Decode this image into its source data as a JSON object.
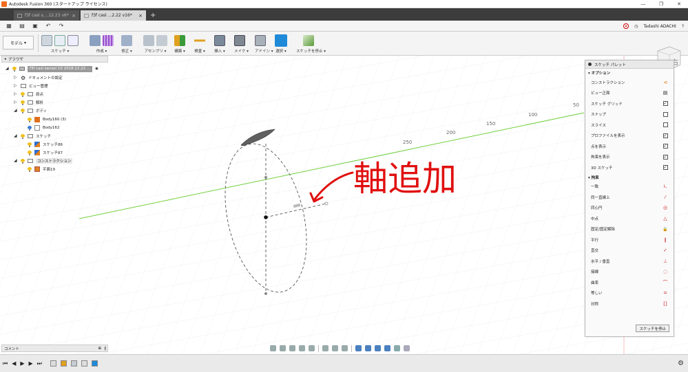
{
  "window": {
    "title": "Autodesk Fusion 360 (スタートアップ ライセンス)",
    "controls": [
      "—",
      "❐",
      "✕"
    ]
  },
  "tabs": [
    {
      "label": "f3f casl s....12.23  v6*",
      "active": false
    },
    {
      "label": "f3f casl ...2.22 v16*",
      "active": true
    }
  ],
  "quickbar": {
    "user": "Tadashi ADACHI",
    "help": "?"
  },
  "toolbar": {
    "workspace": "モデル",
    "groups": [
      {
        "label": "スケッチ ▾",
        "icons": 3
      },
      {
        "label": "作成 ▾",
        "icons": 2
      },
      {
        "label": "修正 ▾",
        "icons": 1
      },
      {
        "label": "アセンブリ ▾",
        "icons": 2
      },
      {
        "label": "構築 ▾",
        "icons": 1
      },
      {
        "label": "検査 ▾",
        "icons": 1
      },
      {
        "label": "挿入 ▾",
        "icons": 1
      },
      {
        "label": "メイク ▾",
        "icons": 1
      },
      {
        "label": "アドイン ▾",
        "icons": 1
      },
      {
        "label": "選択 ▾",
        "icons": 1
      },
      {
        "label": "スケッチを停止 ▾",
        "icons": 1
      }
    ]
  },
  "browser": {
    "title": "ブラウザ",
    "root": "f3f casl sensei 10 2018.12.22 ...",
    "items": [
      {
        "label": "ドキュメントの設定",
        "level": 1
      },
      {
        "label": "ビュー管理",
        "level": 1
      },
      {
        "label": "原点",
        "level": 1
      },
      {
        "label": "解析",
        "level": 1
      },
      {
        "label": "ボディ",
        "level": 1
      },
      {
        "label": "Body160 (3)",
        "level": 2
      },
      {
        "label": "Body162",
        "level": 2
      },
      {
        "label": "スケッチ",
        "level": 1
      },
      {
        "label": "スケッチ86",
        "level": 2
      },
      {
        "label": "スケッチ87",
        "level": 2
      },
      {
        "label": "コンストラクション",
        "level": 1
      },
      {
        "label": "平面19",
        "level": 2
      }
    ]
  },
  "comments": {
    "label": "コメント"
  },
  "viewport": {
    "axis_labels": [
      "250",
      "200",
      "150",
      "100",
      "50"
    ],
    "annotation": "軸追加",
    "viewcube_face": "右"
  },
  "palette": {
    "title": "スケッチ パレット",
    "options_header": "▾ オプション",
    "options": [
      {
        "label": "コンストラクション",
        "control": "⊲"
      },
      {
        "label": "ビュー正面",
        "control": "▤"
      },
      {
        "label": "スケッチ グリッド",
        "control": "✓"
      },
      {
        "label": "スナップ",
        "control": ""
      },
      {
        "label": "スライス",
        "control": ""
      },
      {
        "label": "プロファイルを表示",
        "control": "✓"
      },
      {
        "label": "点を表示",
        "control": "✓"
      },
      {
        "label": "拘束を表示",
        "control": "✓"
      },
      {
        "label": "3D スケッチ",
        "control": "✓"
      }
    ],
    "constraints_header": "▾ 拘束",
    "constraints": [
      {
        "label": "一致",
        "icon": "∟"
      },
      {
        "label": "同一直線上",
        "icon": "⁄"
      },
      {
        "label": "同心円",
        "icon": "◎"
      },
      {
        "label": "中点",
        "icon": "△"
      },
      {
        "label": "固定/固定解除",
        "icon": "🔒"
      },
      {
        "label": "平行",
        "icon": "∥"
      },
      {
        "label": "直交",
        "icon": "✓"
      },
      {
        "label": "水平 / 垂直",
        "icon": "⊥"
      },
      {
        "label": "接線",
        "icon": "◌"
      },
      {
        "label": "曲率",
        "icon": "⌒"
      },
      {
        "label": "等しい",
        "icon": "="
      },
      {
        "label": "対称",
        "icon": "[]"
      }
    ],
    "stop_button": "スケッチを停止"
  },
  "colors": {
    "accent_blue": "#1f8ad8",
    "annotation_red": "#e01010",
    "axis_green": "#6fcf3a",
    "grid": "#e3e8ee"
  }
}
